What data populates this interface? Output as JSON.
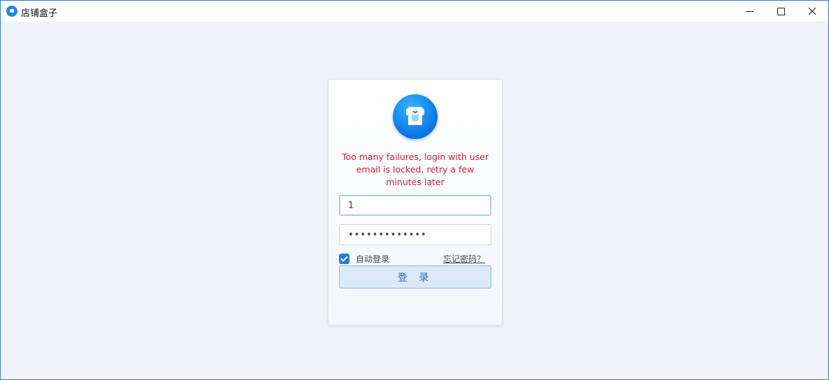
{
  "window": {
    "title": "店铺盒子",
    "controls": {
      "minimize": "minimize",
      "maximize": "maximize",
      "close": "×"
    }
  },
  "login": {
    "error": "Too many failures, login with user email is locked, retry a few minutes later",
    "username_value": "1",
    "password_value": "•••••••••••••",
    "auto_login_label": "自动登录",
    "auto_login_checked": true,
    "forgot_label": "忘记密码？",
    "submit_label": "登 录"
  },
  "colors": {
    "accent": "#1f7de6",
    "error": "#d6202a",
    "window_border": "#2b7bd0",
    "background": "#f0f2f7"
  },
  "icons": {
    "app": "app-logo-icon",
    "logo": "store-icon",
    "check": "checkmark-icon"
  }
}
